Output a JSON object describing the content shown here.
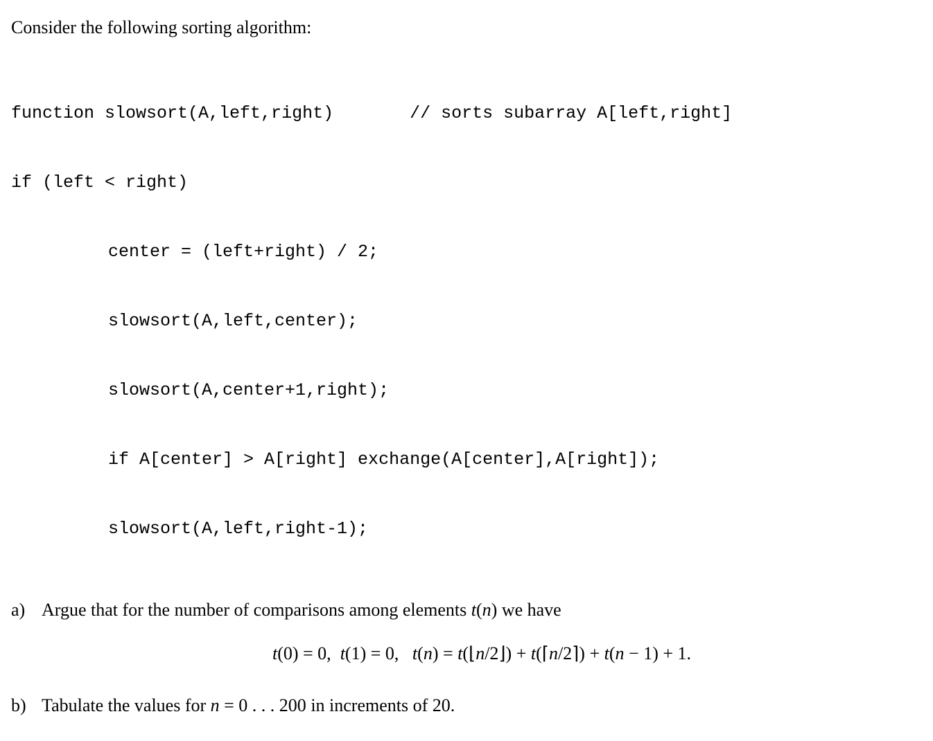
{
  "intro": "Consider the following sorting algorithm:",
  "code": {
    "line1a": "function slowsort(A,left,right)",
    "line1b": "// sorts subarray A[left,right]",
    "line2": "if (left < right)",
    "line3": "center = (left+right) / 2;",
    "line4": "slowsort(A,left,center);",
    "line5": "slowsort(A,center+1,right);",
    "line6": "if A[center] > A[right] exchange(A[center],A[right]);",
    "line7": "slowsort(A,left,right-1);"
  },
  "partA": {
    "label": "a)",
    "text_before": "Argue that for the number of comparisons among elements ",
    "tn": "t(n)",
    "text_after": " we have",
    "equation_t0": "t(0) = 0,",
    "equation_t1": "t(1) = 0,",
    "equation_tn": "t(n) = t(⌊n/2⌋) + t(⌈n/2⌉) + t(n − 1) + 1."
  },
  "partB": {
    "label": "b)",
    "text_before": "Tabulate the values for ",
    "n_eq": "n = 0 . . . 200",
    "text_after": " in increments of 20."
  }
}
